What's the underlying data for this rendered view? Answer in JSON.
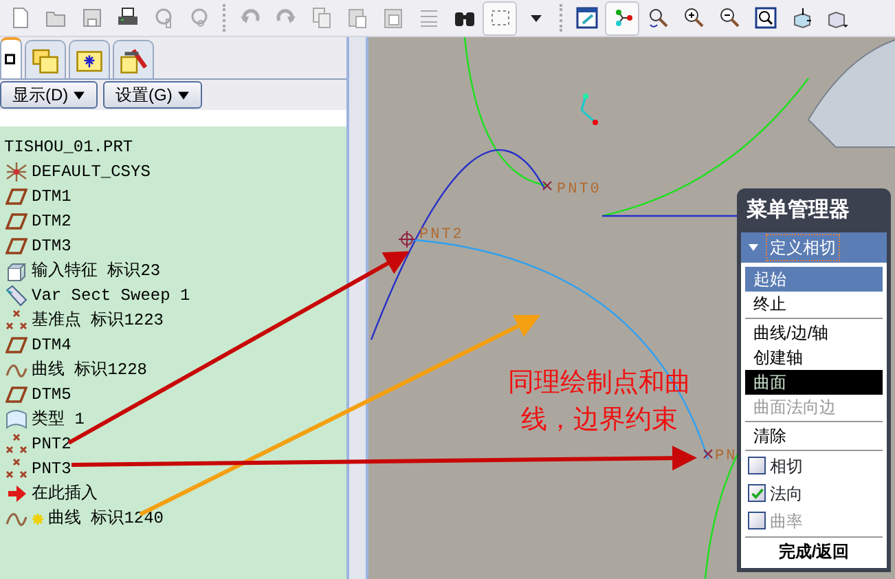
{
  "toolbar": [
    {
      "kind": "new",
      "pressed": false
    },
    {
      "kind": "open",
      "pressed": false
    },
    {
      "kind": "save",
      "pressed": false
    },
    {
      "kind": "print",
      "pressed": false
    },
    {
      "kind": "lock",
      "pressed": false
    },
    {
      "kind": "link",
      "pressed": false
    },
    {
      "kind": "undo",
      "pressed": false
    },
    {
      "kind": "redo",
      "pressed": false
    },
    {
      "kind": "copy",
      "pressed": false
    },
    {
      "kind": "paste",
      "pressed": false
    },
    {
      "kind": "paste-special",
      "pressed": false
    },
    {
      "kind": "list",
      "pressed": false
    },
    {
      "kind": "find",
      "pressed": false
    },
    {
      "kind": "select-box",
      "pressed": true
    },
    {
      "kind": "dropdown",
      "pressed": false
    },
    {
      "kind": "plane",
      "pressed": false
    },
    {
      "kind": "axes",
      "pressed": true
    },
    {
      "kind": "spin",
      "pressed": false
    },
    {
      "kind": "zoom-in",
      "pressed": false
    },
    {
      "kind": "zoom-out",
      "pressed": false
    },
    {
      "kind": "refit",
      "pressed": false
    },
    {
      "kind": "orient",
      "pressed": false
    },
    {
      "kind": "view",
      "pressed": false
    }
  ],
  "tabs": [
    {
      "kind": "tree",
      "selected": true
    },
    {
      "kind": "folders",
      "selected": false
    },
    {
      "kind": "favorites",
      "selected": false
    },
    {
      "kind": "tools",
      "selected": false
    }
  ],
  "panel_buttons": [
    "显示(D)",
    "设置(G)"
  ],
  "tree": {
    "title": "TISHOU_01.PRT",
    "items": [
      {
        "kind": "csys",
        "label": "DEFAULT_CSYS",
        "new": false
      },
      {
        "kind": "plane",
        "label": "DTM1",
        "new": false
      },
      {
        "kind": "plane",
        "label": "DTM2",
        "new": false
      },
      {
        "kind": "plane",
        "label": "DTM3",
        "new": false
      },
      {
        "kind": "import",
        "label": "输入特征 标识23",
        "new": false
      },
      {
        "kind": "sweep",
        "label": "Var Sect Sweep 1",
        "new": false
      },
      {
        "kind": "points",
        "label": "基准点 标识1223",
        "new": false
      },
      {
        "kind": "plane",
        "label": "DTM4",
        "new": false
      },
      {
        "kind": "curve",
        "label": "曲线 标识1228",
        "new": false
      },
      {
        "kind": "plane",
        "label": "DTM5",
        "new": false
      },
      {
        "kind": "surface",
        "label": "类型 1",
        "new": false
      },
      {
        "kind": "points",
        "label": "PNT2",
        "new": false
      },
      {
        "kind": "points",
        "label": "PNT3",
        "new": false
      },
      {
        "kind": "insert",
        "label": "在此插入",
        "new": false
      },
      {
        "kind": "curve",
        "label": "曲线 标识1240",
        "new": true
      }
    ]
  },
  "canvas": {
    "point_labels": [
      "PNT0",
      "PNT2",
      "PN"
    ],
    "annotation": "同理绘制点和曲线，边界约束"
  },
  "menu_manager": {
    "title": "菜单管理器",
    "section": {
      "label": "定义相切",
      "expanded": true
    },
    "groups": [
      [
        {
          "kind": "item",
          "label": "起始",
          "selected": true,
          "hot": false,
          "disabled": false
        },
        {
          "kind": "item",
          "label": "终止",
          "selected": false,
          "hot": false,
          "disabled": false
        }
      ],
      [
        {
          "kind": "item",
          "label": "曲线/边/轴",
          "selected": false,
          "hot": false,
          "disabled": false
        },
        {
          "kind": "item",
          "label": "创建轴",
          "selected": false,
          "hot": false,
          "disabled": false
        },
        {
          "kind": "item",
          "label": "曲面",
          "selected": false,
          "hot": true,
          "disabled": false
        },
        {
          "kind": "item",
          "label": "曲面法向边",
          "selected": false,
          "hot": false,
          "disabled": true
        }
      ],
      [
        {
          "kind": "item",
          "label": "清除",
          "selected": false,
          "hot": false,
          "disabled": false
        }
      ],
      [
        {
          "kind": "checkbox",
          "label": "相切",
          "checked": false,
          "disabled": false
        },
        {
          "kind": "checkbox",
          "label": "法向",
          "checked": true,
          "disabled": false
        },
        {
          "kind": "checkbox",
          "label": "曲率",
          "checked": false,
          "disabled": true
        }
      ],
      [
        {
          "kind": "done",
          "label": "完成/返回",
          "selected": false,
          "hot": false,
          "disabled": false
        }
      ]
    ]
  }
}
